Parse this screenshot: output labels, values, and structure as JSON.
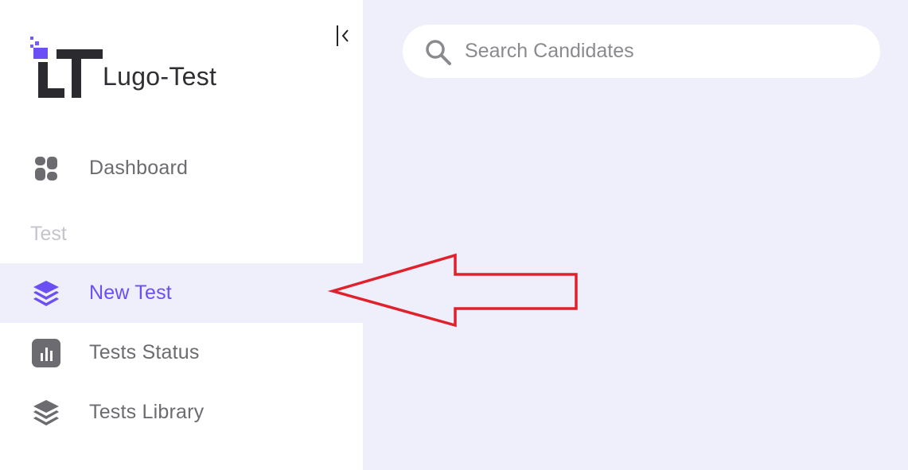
{
  "brand": {
    "name": "Lugo-Test",
    "accent_color": "#6c4ff4"
  },
  "sidebar": {
    "collapse_icon": "collapse-left-icon",
    "dashboard": {
      "label": "Dashboard",
      "icon": "dashboard-icon"
    },
    "section_label": "Test",
    "items": [
      {
        "label": "New Test",
        "icon": "layers-icon",
        "active": true
      },
      {
        "label": "Tests Status",
        "icon": "bar-chart-icon",
        "active": false
      },
      {
        "label": "Tests Library",
        "icon": "stack-icon",
        "active": false
      }
    ]
  },
  "search": {
    "placeholder": "Search Candidates",
    "value": "",
    "icon": "search-icon"
  },
  "annotation": {
    "type": "arrow",
    "color": "#e0202a",
    "points_to": "New Test"
  }
}
